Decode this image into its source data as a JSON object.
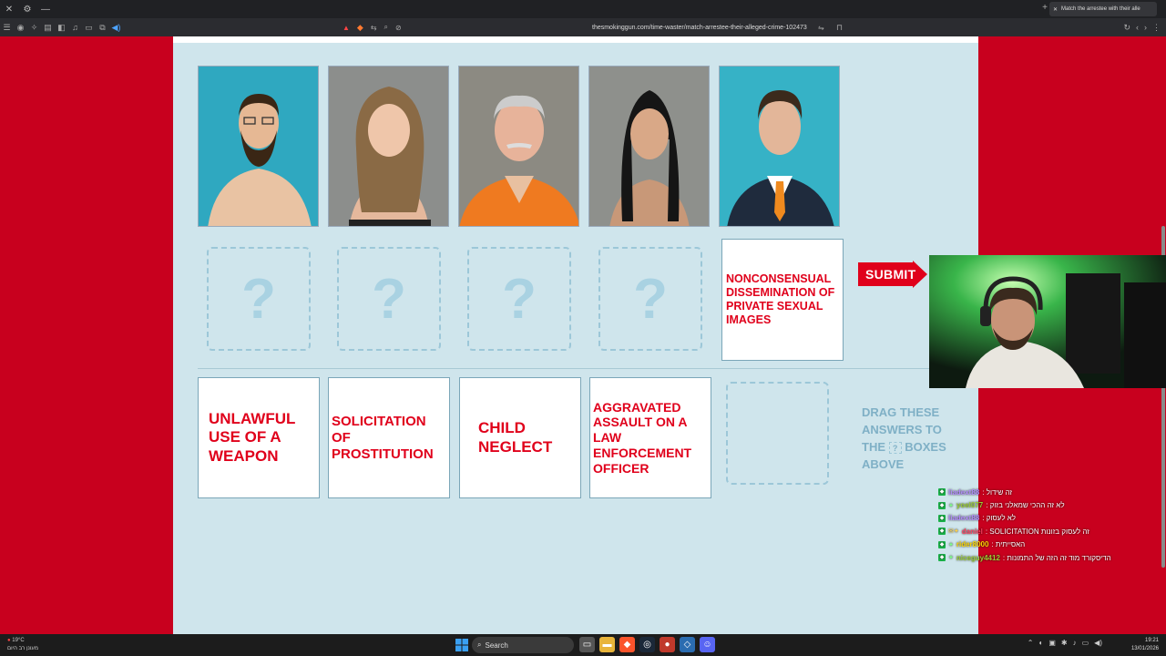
{
  "browser": {
    "tab_title": "Match the arrestee with their alle",
    "url": "thesmokinggun.com/time-waster/match-arrestee-their-alleged-crime-102473"
  },
  "game": {
    "slot_mark": "?",
    "placed_answer": "Nonconsensual Dissemination of Private Sexual Images",
    "submit_label": "SUBMIT",
    "answers": [
      "Unlawful use of a weapon",
      "Solicitation of prostitution",
      "Child Neglect",
      "Aggravated assault on a law enforcement officer"
    ],
    "hint_line1": "DRAG THESE",
    "hint_line2": "ANSWERS TO",
    "hint_the": "THE",
    "hint_mark": "?",
    "hint_line3": "BOXES",
    "hint_line4": "ABOVE"
  },
  "chat": [
    {
      "user": "liadext88",
      "text": ": זה שידול",
      "color": "#b48cff"
    },
    {
      "user": "yoel077",
      "text": ": לא זה ההכי שמאלני בזוק",
      "color": "#9acd32"
    },
    {
      "user": "liadext88",
      "text": ": לא לעסוק",
      "color": "#b48cff"
    },
    {
      "user": "daniel",
      "text": ": SOLICITATION זה לעסוק בזונות",
      "color": "#ff4060"
    },
    {
      "user": "rider8000",
      "text": ": האסייתית",
      "color": "#ffd700"
    },
    {
      "user": "niceguy4412",
      "text": ": הדיסקורד מוד זה הזה של התמונות",
      "color": "#9acd32"
    }
  ],
  "taskbar": {
    "search_label": "Search",
    "weather_temp": "19°C",
    "weather_desc": "מעונן רב היום",
    "time": "19:21",
    "date": "13/01/2026"
  }
}
